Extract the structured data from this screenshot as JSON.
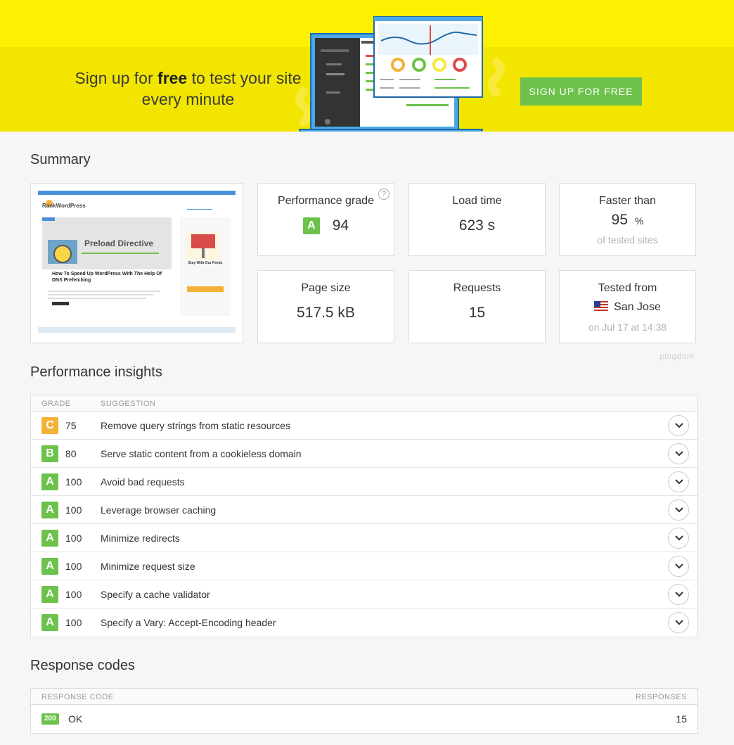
{
  "banner": {
    "text_before": "Sign up for ",
    "text_bold": "free",
    "text_after": " to test your site every minute",
    "button_label": "SIGN UP FOR FREE"
  },
  "summary": {
    "title": "Summary",
    "thumbnail": {
      "logo": "RankWordPress",
      "article_image_title": "Preload Directive",
      "article_title": "How To Speed Up WordPress With The Help Of DNS Prefetching",
      "sidebar_title": "Stay With Our Feeds"
    },
    "cards": {
      "performance": {
        "label": "Performance grade",
        "grade": "A",
        "value": "94"
      },
      "load_time": {
        "label": "Load time",
        "value": "623 s"
      },
      "faster_than": {
        "label": "Faster than",
        "value": "95",
        "unit": "%",
        "sub": "of tested sites"
      },
      "page_size": {
        "label": "Page size",
        "value": "517.5 kB"
      },
      "requests": {
        "label": "Requests",
        "value": "15"
      },
      "tested_from": {
        "label": "Tested from",
        "location": "San Jose",
        "date": "on Jul 17 at 14:38"
      }
    },
    "brand": "pingdom"
  },
  "insights": {
    "title": "Performance insights",
    "headers": {
      "grade": "GRADE",
      "suggestion": "SUGGESTION"
    },
    "rows": [
      {
        "grade": "C",
        "score": "75",
        "suggestion": "Remove query strings from static resources"
      },
      {
        "grade": "B",
        "score": "80",
        "suggestion": "Serve static content from a cookieless domain"
      },
      {
        "grade": "A",
        "score": "100",
        "suggestion": "Avoid bad requests"
      },
      {
        "grade": "A",
        "score": "100",
        "suggestion": "Leverage browser caching"
      },
      {
        "grade": "A",
        "score": "100",
        "suggestion": "Minimize redirects"
      },
      {
        "grade": "A",
        "score": "100",
        "suggestion": "Minimize request size"
      },
      {
        "grade": "A",
        "score": "100",
        "suggestion": "Specify a cache validator"
      },
      {
        "grade": "A",
        "score": "100",
        "suggestion": "Specify a Vary: Accept-Encoding header"
      }
    ]
  },
  "response_codes": {
    "title": "Response codes",
    "headers": {
      "code": "RESPONSE CODE",
      "responses": "RESPONSES"
    },
    "rows": [
      {
        "code": "200",
        "label": "OK",
        "responses": "15"
      }
    ]
  },
  "colors": {
    "grade_a": "#6cc24a",
    "grade_b": "#6cc24a",
    "grade_c": "#f2b237",
    "banner_yellow": "#fdf000",
    "accent_green": "#6cc24a"
  }
}
